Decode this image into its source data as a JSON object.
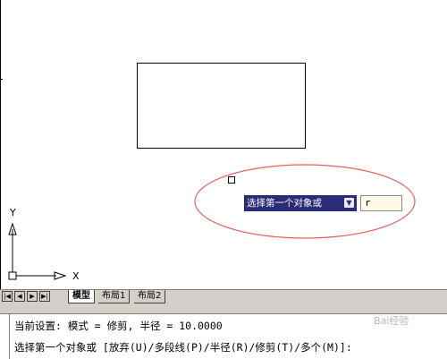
{
  "canvas": {
    "tooltip_prompt": "选择第一个对象或",
    "tooltip_dropdown_icon": "down-arrow-icon",
    "input_value": "r",
    "ucs_x_label": "X",
    "ucs_y_label": "Y",
    "highlight_color": "#e06060"
  },
  "tabbar": {
    "tabs": [
      {
        "label": "模型",
        "active": true
      },
      {
        "label": "布局1",
        "active": false
      },
      {
        "label": "布局2",
        "active": false
      }
    ]
  },
  "command": {
    "line1": "当前设置: 模式 = 修剪, 半径 = 10.0000",
    "line2": "选择第一个对象或 [放弃(U)/多段线(P)/半径(R)/修剪(T)/多个(M)]:"
  },
  "watermark": "Bai经验"
}
